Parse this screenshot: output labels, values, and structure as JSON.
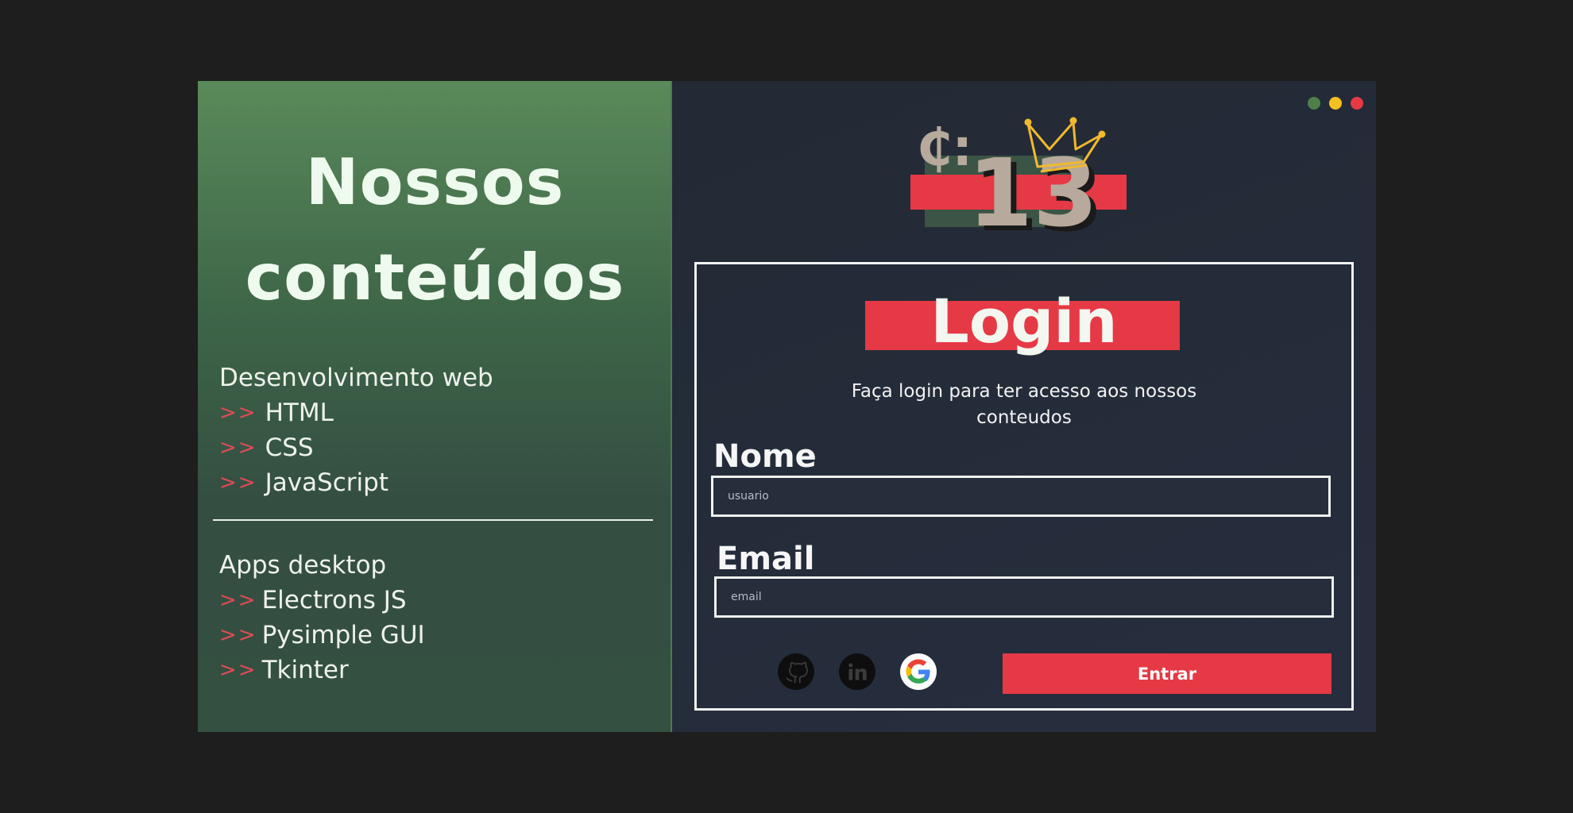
{
  "left_panel": {
    "title_line1": "Nossos",
    "title_line2": "conteúdos",
    "groups": [
      {
        "title": "Desenvolvimento web",
        "items": [
          "HTML",
          "CSS",
          "JavaScript"
        ]
      },
      {
        "title": "Apps desktop",
        "items": [
          "Electrons JS",
          "Pysimple GUI",
          "Tkinter"
        ]
      }
    ],
    "bullet": ">>"
  },
  "logo": {
    "symbol": "₵:",
    "number": "13",
    "icon": "crown-icon"
  },
  "login": {
    "title": "Login",
    "subtitle": "Faça login para ter acesso aos nossos conteudos",
    "name_label": "Nome",
    "name_placeholder": "usuario",
    "email_label": "Email",
    "email_placeholder": "email",
    "submit_label": "Entrar",
    "social_icons": [
      "github-icon",
      "linkedin-icon",
      "google-icon"
    ]
  },
  "window_controls": [
    "minimize",
    "maximize",
    "close"
  ],
  "colors": {
    "accent_red": "#e63946",
    "green_panel": "#3e6648",
    "dark_panel": "#262d3b",
    "crown_yellow": "#f2b82e",
    "logo_tan": "#b7a99b",
    "dot_green": "#4e7f4a",
    "dot_yellow": "#f4c01f",
    "dot_red": "#e63946"
  }
}
